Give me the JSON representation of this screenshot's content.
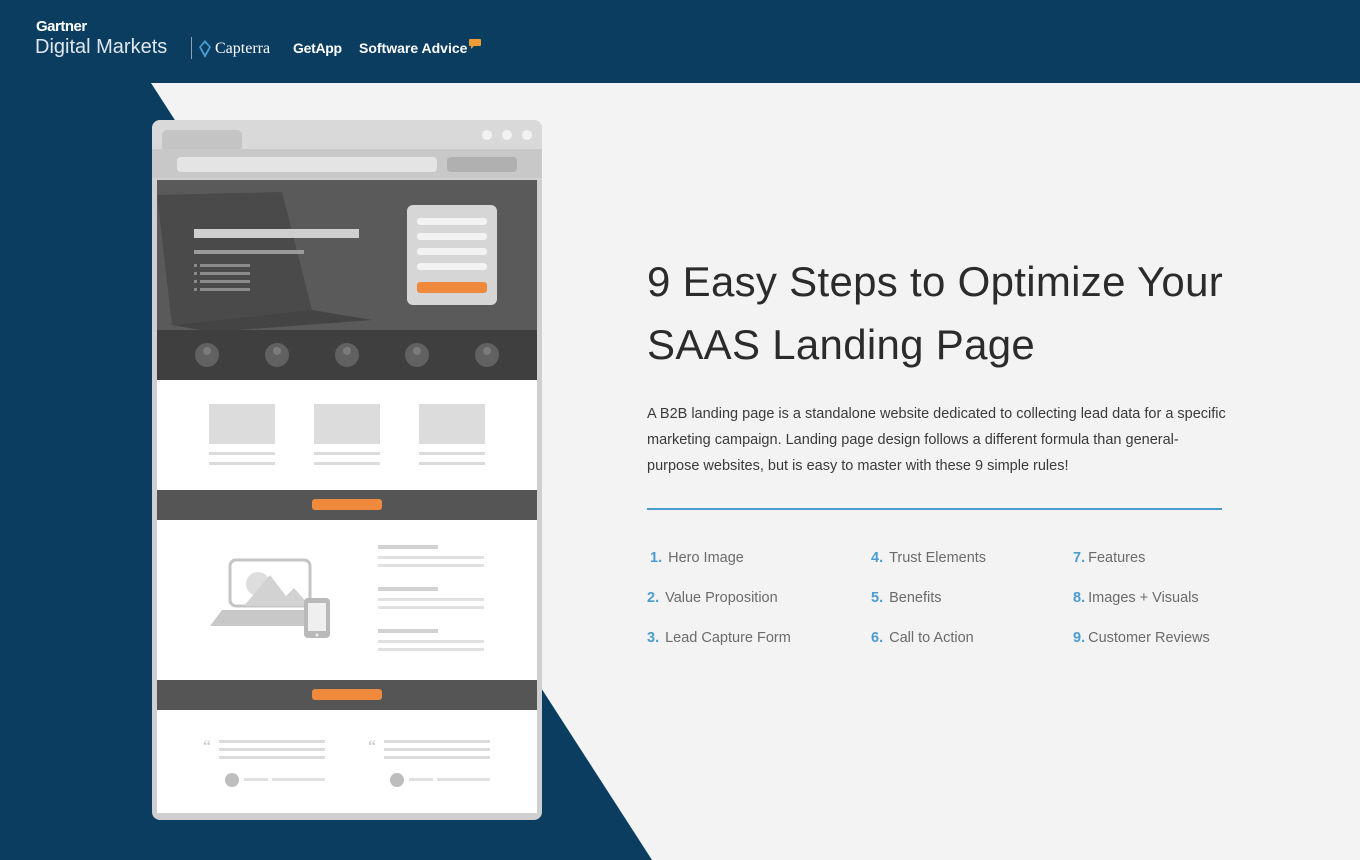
{
  "header": {
    "gartner": "Gartner",
    "digital_markets": "Digital Markets",
    "partners": [
      "Capterra",
      "GetApp",
      "Software Advice"
    ]
  },
  "hero": {
    "title": "9 Easy Steps to Optimize Your SAAS Landing Page",
    "description": "A B2B landing page is a standalone website dedicated to collecting lead data for a specific marketing campaign. Landing page design follows a different formula than general-purpose websites, but is easy to master with these 9 simple rules!"
  },
  "steps": [
    {
      "num": "1.",
      "label": "Hero Image"
    },
    {
      "num": "2.",
      "label": "Value Proposition"
    },
    {
      "num": "3.",
      "label": "Lead Capture Form"
    },
    {
      "num": "4.",
      "label": "Trust Elements"
    },
    {
      "num": "5.",
      "label": "Benefits"
    },
    {
      "num": "6.",
      "label": "Call to Action"
    },
    {
      "num": "7.",
      "label": "Features"
    },
    {
      "num": "8.",
      "label": "Images + Visuals"
    },
    {
      "num": "9.",
      "label": "Customer Reviews"
    }
  ],
  "colors": {
    "navy": "#0b3d61",
    "panel": "#f3f3f3",
    "accent_blue": "#4a9cd0",
    "cta_orange": "#ef8a3c"
  }
}
